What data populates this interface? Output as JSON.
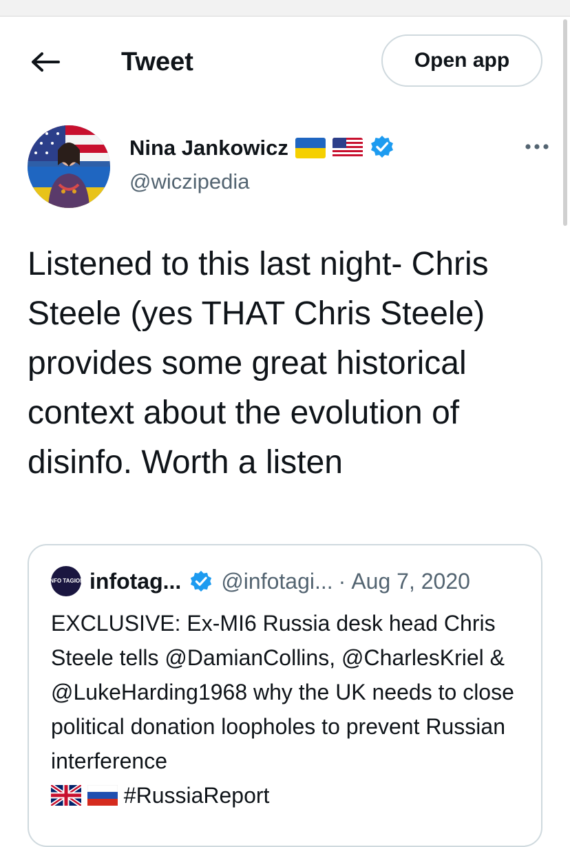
{
  "header": {
    "title": "Tweet",
    "open_app_label": "Open app"
  },
  "author": {
    "name": "Nina Jankowicz",
    "handle": "@wiczipedia",
    "flags": [
      "ukraine-flag-icon",
      "us-flag-icon"
    ],
    "verified": true
  },
  "tweet": {
    "text": "Listened to this last night- Chris Steele (yes THAT Chris Steele) provides some great historical context about the evolution of disinfo. Worth a listen"
  },
  "quoted_tweet": {
    "name": "infotag...",
    "handle": "@infotagi...",
    "separator": "·",
    "date": "Aug 7, 2020",
    "avatar_text": "INFO TAGION",
    "text": "EXCLUSIVE: Ex-MI6 Russia desk head Chris Steele tells @DamianCollins, @CharlesKriel & @LukeHarding1968 why the UK needs to close political donation loopholes to prevent Russian interference",
    "hashtag": "#RussiaReport",
    "flags": [
      "uk-flag-icon",
      "russia-flag-icon"
    ]
  },
  "colors": {
    "primary_text": "#0f1419",
    "secondary_text": "#536471",
    "verified_blue": "#1d9bf0",
    "border": "#cfd9de"
  }
}
